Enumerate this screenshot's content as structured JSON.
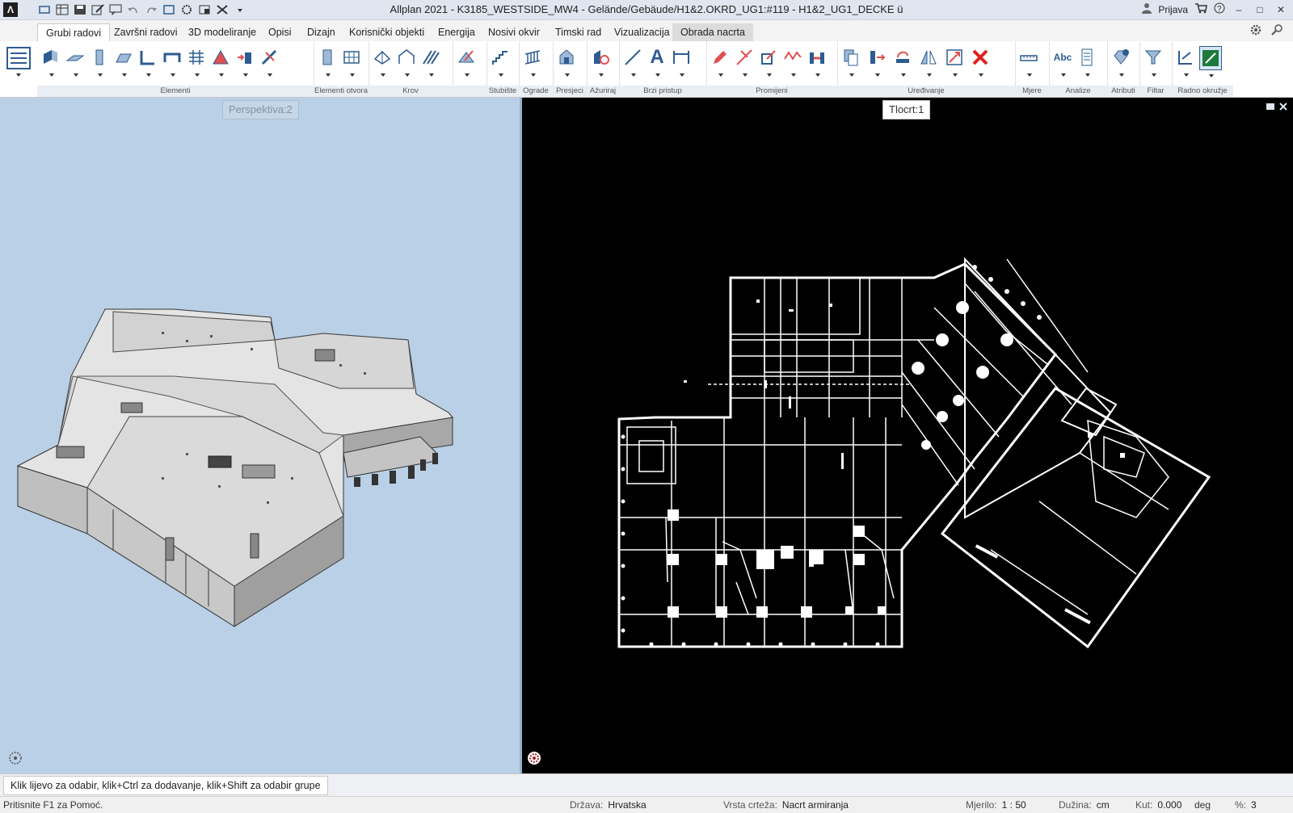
{
  "titlebar": {
    "logo": "Λ",
    "title": "Allplan 2021 - K3185_WESTSIDE_MW4 - Gelände/Gebäude/H1&2.OKRD_UG1:#119 - H1&2_UG1_DECKE ü",
    "user_label": "Prijava",
    "window_controls": [
      "–",
      "□",
      "✕"
    ]
  },
  "tabs": [
    {
      "label": "Grubi radovi",
      "state": "active"
    },
    {
      "label": "Završni radovi"
    },
    {
      "label": "3D modeliranje"
    },
    {
      "label": "Opisi"
    },
    {
      "label": "Dizajn"
    },
    {
      "label": "Korisnički objekti"
    },
    {
      "label": "Energija"
    },
    {
      "label": "Nosivi okvir"
    },
    {
      "label": "Timski rad"
    },
    {
      "label": "Vizualizacija"
    },
    {
      "label": "Obrada nacrta",
      "state": "highlight"
    }
  ],
  "ribbon_groups": [
    {
      "label": "Elementi",
      "icons": [
        "wall-icon",
        "slab-icon",
        "column-icon",
        "beam-icon",
        "stair-bar-icon",
        "lintel-icon",
        "grid-icon",
        "roof-element-icon",
        "insert-icon",
        "modify-icon"
      ]
    },
    {
      "label": "Elementi otvora",
      "icons": [
        "door-icon",
        "window-grid-icon"
      ]
    },
    {
      "label": "Krov",
      "icons": [
        "roof-icon",
        "dormer-icon",
        "roof-plane-icon"
      ]
    },
    {
      "label": "",
      "icons": [
        "edit-roof-icon"
      ]
    },
    {
      "label": "Stubište",
      "icons": [
        "staircase-icon"
      ]
    },
    {
      "label": "Ograde",
      "icons": [
        "railing-icon"
      ]
    },
    {
      "label": "Presjeci",
      "icons": [
        "section-icon"
      ]
    },
    {
      "label": "Ažuriraj",
      "icons": [
        "update-icon"
      ]
    },
    {
      "label": "Brzi pristup",
      "icons": [
        "line-icon",
        "text-icon",
        "dimension-icon"
      ]
    },
    {
      "label": "Promijeni",
      "icons": [
        "pencil-icon",
        "trim-icon",
        "stretch-icon",
        "polyline-icon",
        "join-icon"
      ]
    },
    {
      "label": "Uređivanje",
      "icons": [
        "copy-icon",
        "move-icon",
        "rotate-icon",
        "mirror-icon",
        "scale-icon",
        "delete-icon"
      ]
    },
    {
      "label": "Mjere",
      "icons": [
        "measure-icon"
      ]
    },
    {
      "label": "Analize",
      "icons": [
        "abc-icon",
        "report-icon"
      ]
    },
    {
      "label": "Atributi",
      "icons": [
        "attributes-icon"
      ]
    },
    {
      "label": "Filtar",
      "icons": [
        "filter-icon"
      ]
    },
    {
      "label": "Radno okružje",
      "icons": [
        "workspace-icon",
        "active-viewport-icon"
      ]
    }
  ],
  "ribbon_text": {
    "abc": "Abc",
    "a": "A"
  },
  "viewports": {
    "left": {
      "label": "Perspektiva:2",
      "background": "#b9d0e6"
    },
    "right": {
      "label": "Tlocrt:1",
      "background": "#000000"
    }
  },
  "prompt": "Klik lijevo za odabir, klik+Ctrl za dodavanje, klik+Shift za odabir grupe",
  "status": {
    "help": "Pritisnite F1 za Pomoć.",
    "country_label": "Država:",
    "country": "Hrvatska",
    "drawing_type_label": "Vrsta crteža:",
    "drawing_type": "Nacrt armiranja",
    "scale_label": "Mjerilo:",
    "scale": "1 : 50",
    "length_label": "Dužina:",
    "length_unit": "cm",
    "angle_label": "Kut:",
    "angle": "0.000",
    "angle_unit": "deg",
    "percent_label": "%:",
    "percent": "3"
  }
}
